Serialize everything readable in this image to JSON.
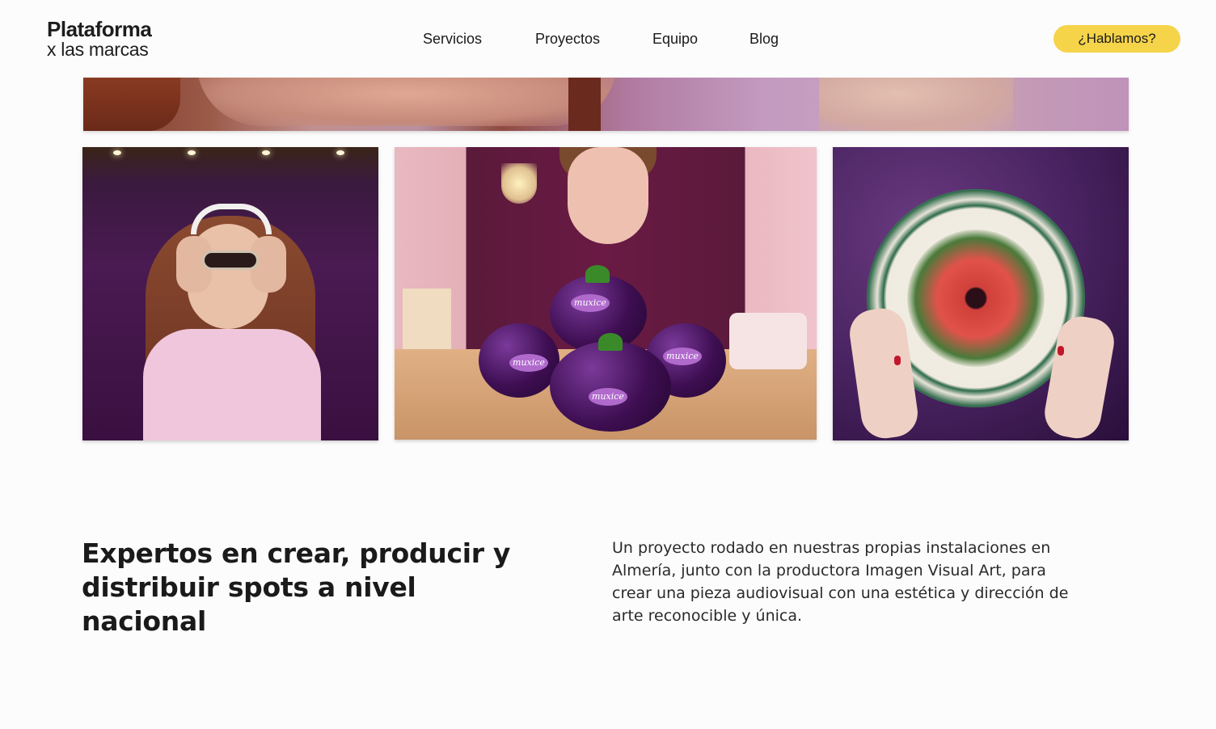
{
  "header": {
    "logo_line1": "Plataforma",
    "logo_line2": "x las marcas",
    "nav": [
      "Servicios",
      "Proyectos",
      "Equipo",
      "Blog"
    ],
    "cta_label": "¿Hablamos?"
  },
  "gallery": {
    "photo2_labels": [
      "muxice",
      "muxice",
      "muxice",
      "muxice"
    ]
  },
  "content": {
    "headline": "Expertos en crear, producir y distribuir spots a nivel nacional",
    "description": "Un proyecto rodado en nuestras propias instalaciones en Almería, junto con la productora Imagen Visual Art, para crear una pieza audiovisual con una estética y dirección de arte reconocible y única."
  },
  "colors": {
    "accent": "#f5d44a",
    "background": "#fcfcfc",
    "text": "#1a1a1a"
  }
}
